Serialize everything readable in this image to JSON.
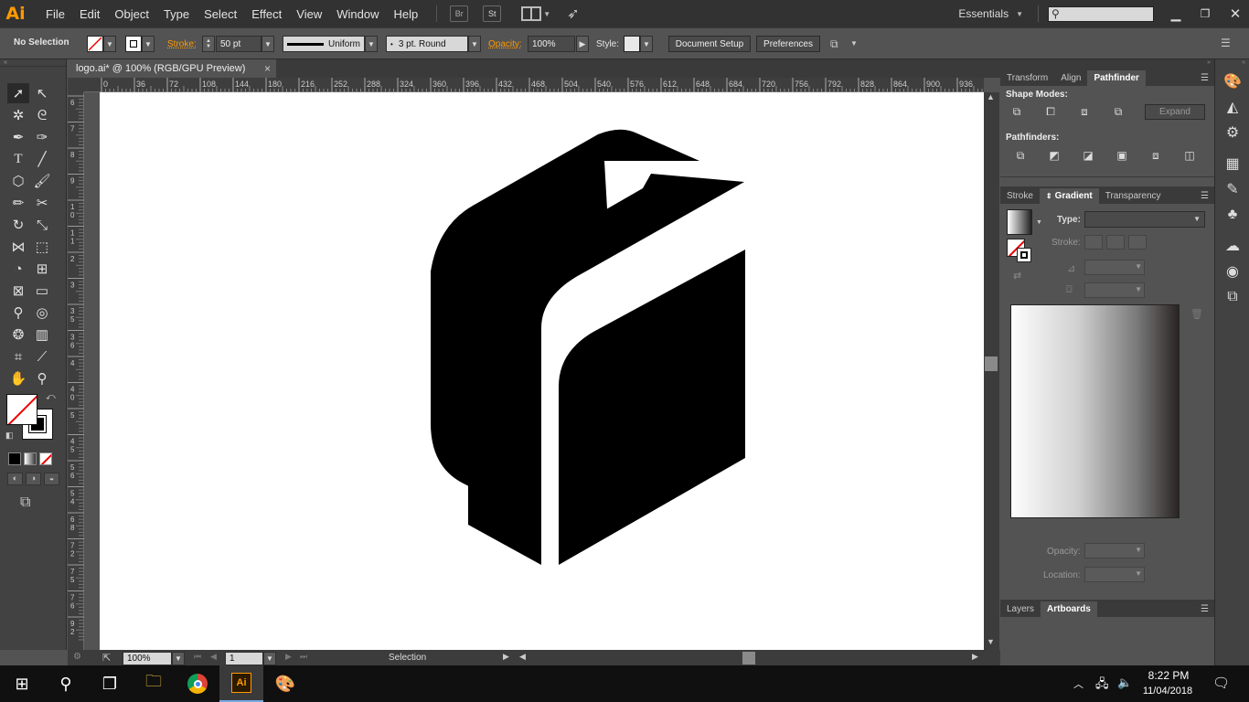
{
  "app": {
    "logo": "Ai"
  },
  "menubar": {
    "items": [
      "File",
      "Edit",
      "Object",
      "Type",
      "Select",
      "Effect",
      "View",
      "Window",
      "Help"
    ],
    "bridge": "Br",
    "stock": "St",
    "workspace": "Essentials",
    "search_placeholder": ""
  },
  "controlbar": {
    "selection": "No Selection",
    "stroke_label": "Stroke:",
    "stroke_value": "50 pt",
    "profile": "Uniform",
    "brush": "3 pt. Round",
    "opacity_label": "Opacity:",
    "opacity_value": "100%",
    "style_label": "Style:",
    "document_setup": "Document Setup",
    "preferences": "Preferences"
  },
  "document": {
    "tab_title": "logo.ai* @ 100% (RGB/GPU Preview)",
    "close": "×"
  },
  "ruler": {
    "top": [
      "0",
      "36",
      "72",
      "108",
      "144",
      "180",
      "216",
      "252",
      "288",
      "324",
      "360",
      "396",
      "432",
      "468",
      "504",
      "540",
      "576",
      "612",
      "648",
      "684",
      "720",
      "756",
      "792",
      "828",
      "864",
      "900",
      "936"
    ],
    "left": [
      "6",
      "7",
      "8",
      "9",
      "1\n0",
      "1\n1",
      "2",
      "3",
      "3\n5",
      "3\n6",
      "4",
      "4\n0",
      "5",
      "4\n5",
      "5\n6",
      "5\n4",
      "6\n8",
      "7\n2",
      "7\n5",
      "7\n6",
      "9\n2"
    ]
  },
  "statusbar": {
    "zoom": "100%",
    "artboard": "1",
    "tool": "Selection"
  },
  "panels": {
    "group1_tabs": [
      "Transform",
      "Align",
      "Pathfinder"
    ],
    "shape_modes": "Shape Modes:",
    "expand": "Expand",
    "pathfinders": "Pathfinders:",
    "group2_tabs": [
      "Stroke",
      "Gradient",
      "Transparency"
    ],
    "type_label": "Type:",
    "stroke_label": "Stroke:",
    "opacity_label": "Opacity:",
    "location_label": "Location:",
    "group3_tabs": [
      "Layers",
      "Artboards"
    ]
  },
  "taskbar": {
    "time": "8:22 PM",
    "date": "11/04/2018"
  },
  "colors": {
    "accent": "#ff9a00",
    "artwork": "#000000",
    "artboard": "#ffffff"
  }
}
